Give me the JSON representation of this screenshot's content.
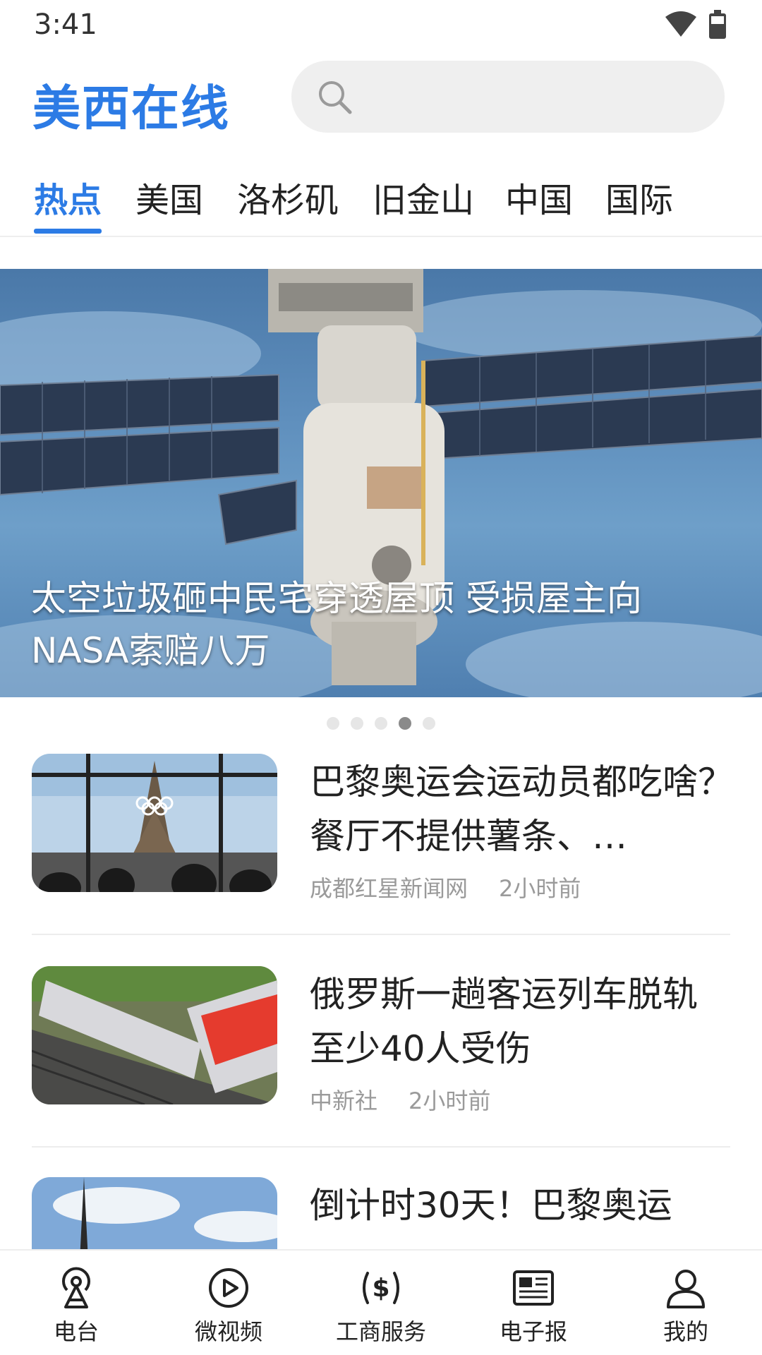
{
  "status_bar": {
    "time": "3:41",
    "icons": [
      "wifi-icon",
      "battery-icon"
    ]
  },
  "header": {
    "logo": "美西在线",
    "search_placeholder": "",
    "brand_color": "#2c7be5"
  },
  "tabs": [
    {
      "label": "热点",
      "active": true
    },
    {
      "label": "美国",
      "active": false
    },
    {
      "label": "洛杉矶",
      "active": false
    },
    {
      "label": "旧金山",
      "active": false
    },
    {
      "label": "中国",
      "active": false
    },
    {
      "label": "国际",
      "active": false
    }
  ],
  "banner": {
    "caption_line1": "太空垃圾砸中民宅穿透屋顶 受损屋主向",
    "caption_line2": "NASA索赔八万",
    "image": "space-station-photo",
    "dots_total": 5,
    "active_dot": 4
  },
  "news": [
    {
      "title": "巴黎奥运会运动员都吃啥？餐厅不提供薯条、…",
      "source": "成都红星新闻网",
      "time": "2小时前",
      "image": "eiffel-tower-olympic-rings-photo"
    },
    {
      "title": "俄罗斯一趟客运列车脱轨 至少40人受伤",
      "source": "中新社",
      "time": "2小时前",
      "image": "derailed-train-photo"
    },
    {
      "title": "倒计时30天！巴黎奥运",
      "source": "",
      "time": "",
      "image": "eiffel-tower-sky-photo"
    }
  ],
  "bottom_nav": [
    {
      "label": "电台",
      "icon": "radio-tower-icon"
    },
    {
      "label": "微视频",
      "icon": "play-circle-icon"
    },
    {
      "label": "工商服务",
      "icon": "dollar-icon"
    },
    {
      "label": "电子报",
      "icon": "newspaper-icon"
    },
    {
      "label": "我的",
      "icon": "user-icon"
    }
  ]
}
